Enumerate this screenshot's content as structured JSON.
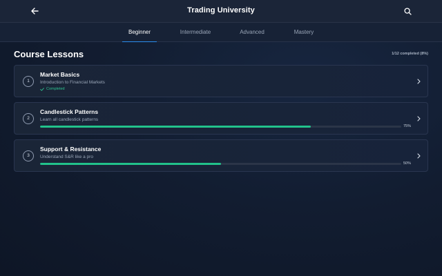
{
  "header": {
    "title": "Trading University",
    "back_icon": "arrow-left-icon",
    "search_icon": "search-icon"
  },
  "tabs": [
    {
      "label": "Beginner",
      "active": true
    },
    {
      "label": "Intermediate",
      "active": false
    },
    {
      "label": "Advanced",
      "active": false
    },
    {
      "label": "Mastery",
      "active": false
    }
  ],
  "section": {
    "title": "Course Lessons",
    "summary": "1/12 completed (8%)"
  },
  "lessons": [
    {
      "number": "1",
      "title": "Market Basics",
      "subtitle": "Introduction to Financial Markets",
      "status": "Completed",
      "status_icon": "check-icon"
    },
    {
      "number": "2",
      "title": "Candlestick Patterns",
      "subtitle": "Learn all candlestick patterns",
      "progress": 0.75,
      "progress_label": "75%"
    },
    {
      "number": "3",
      "title": "Support & Resistance",
      "subtitle": "Understand S&R like a pro",
      "progress": 0.5,
      "progress_label": "50%"
    }
  ],
  "colors": {
    "accent": "#2b8ef0",
    "progress": "#22c28b",
    "completed": "#2fc590"
  }
}
